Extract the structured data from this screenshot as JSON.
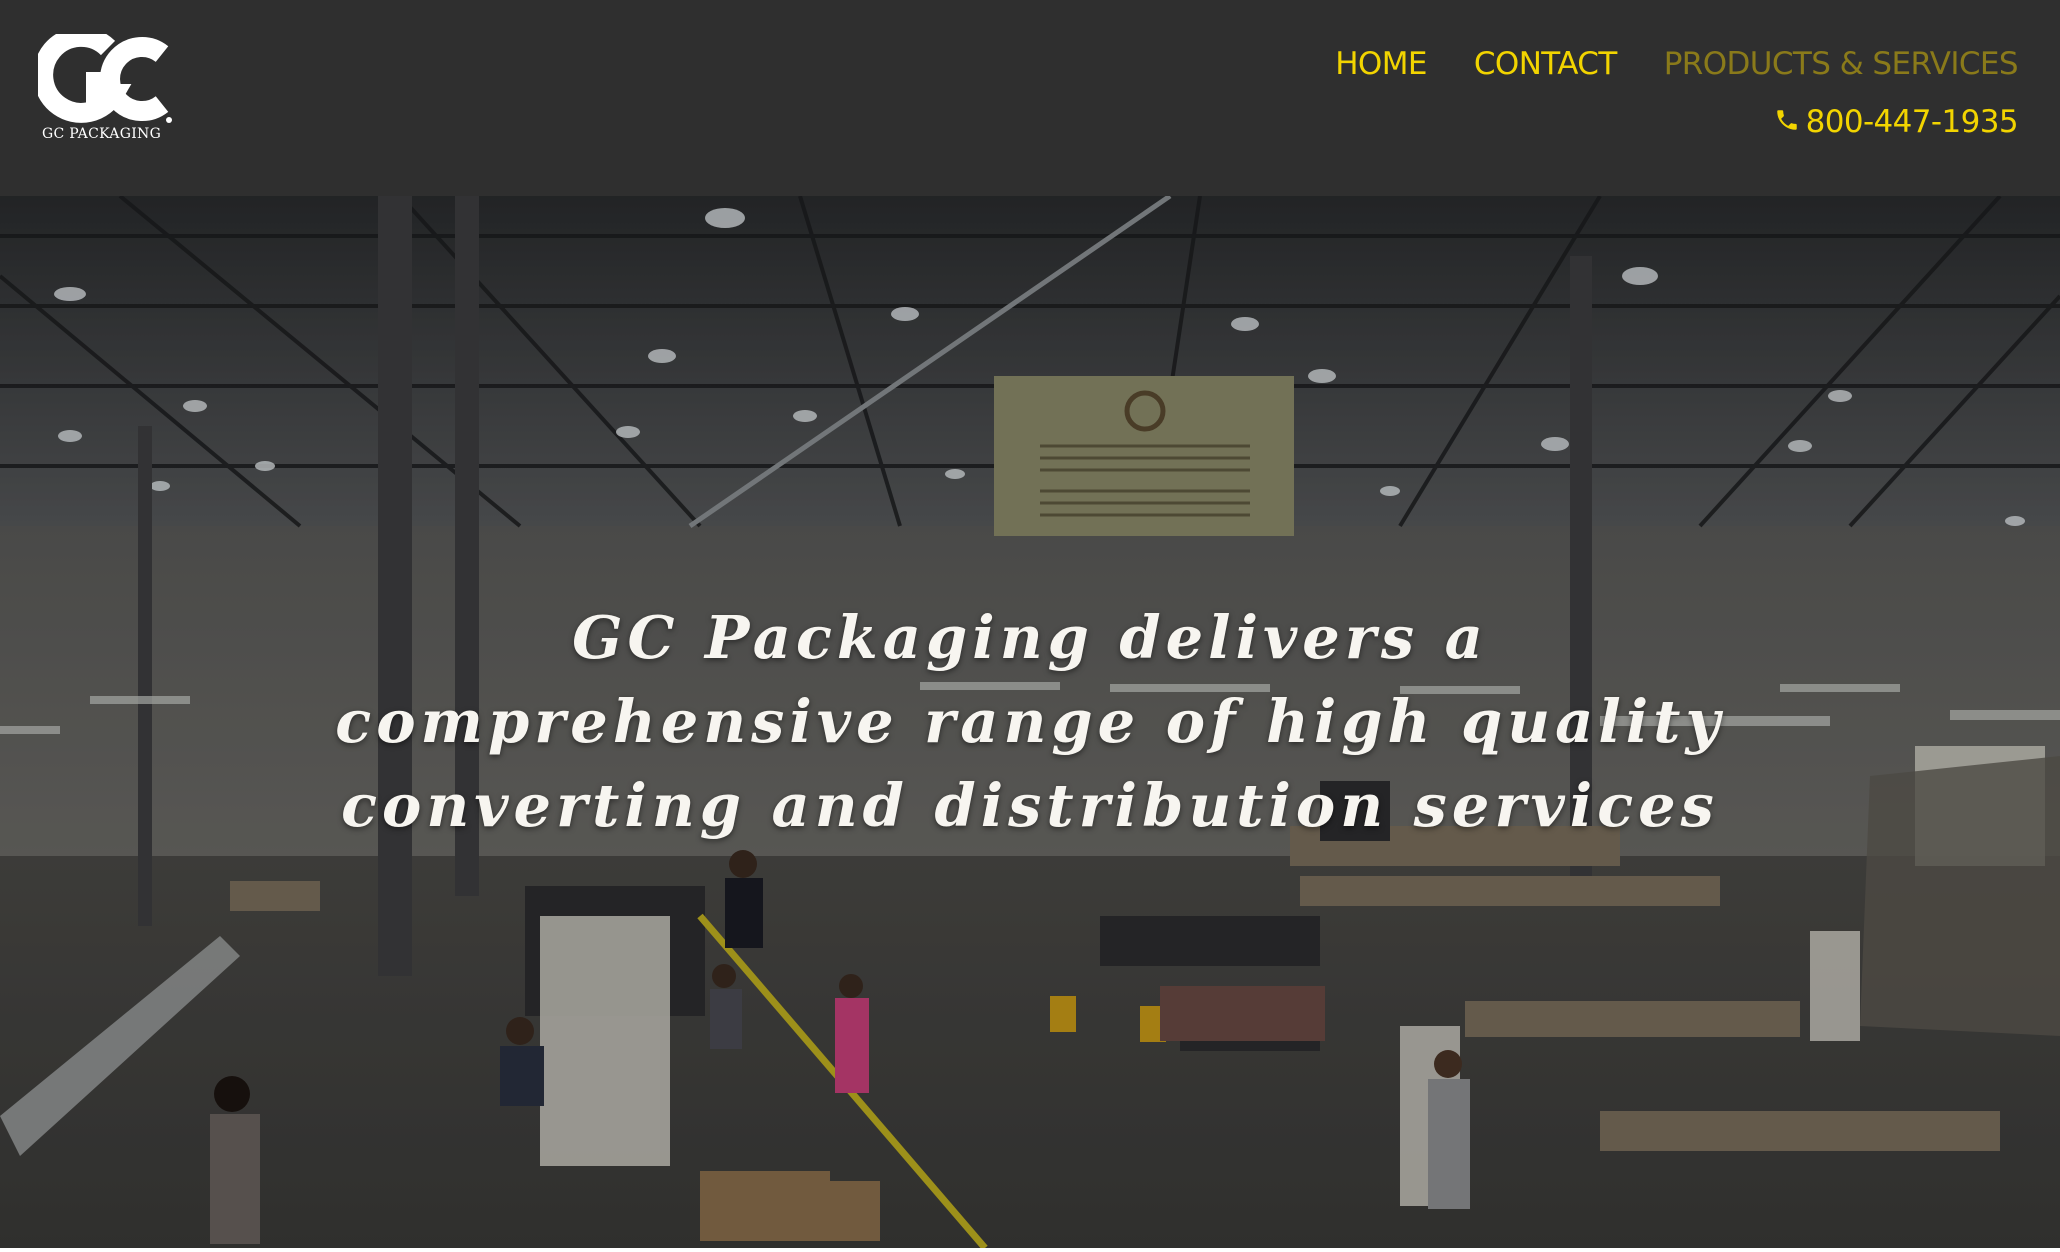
{
  "header": {
    "logo_text": "GC PACKAGING",
    "nav": [
      {
        "label": "HOME",
        "muted": false
      },
      {
        "label": "CONTACT",
        "muted": false
      },
      {
        "label": "PRODUCTS & SERVICES",
        "muted": true
      }
    ],
    "phone": "800-447-1935",
    "phone_icon": "phone-icon"
  },
  "hero": {
    "headline": "GC Packaging delivers a comprehensive range of high quality converting and distribution services",
    "background": "warehouse-photo"
  },
  "colors": {
    "header_bg": "#2f2f2f",
    "accent": "#f2d400",
    "accent_muted": "#8a7a1a",
    "hero_text": "#f7f5f0"
  }
}
